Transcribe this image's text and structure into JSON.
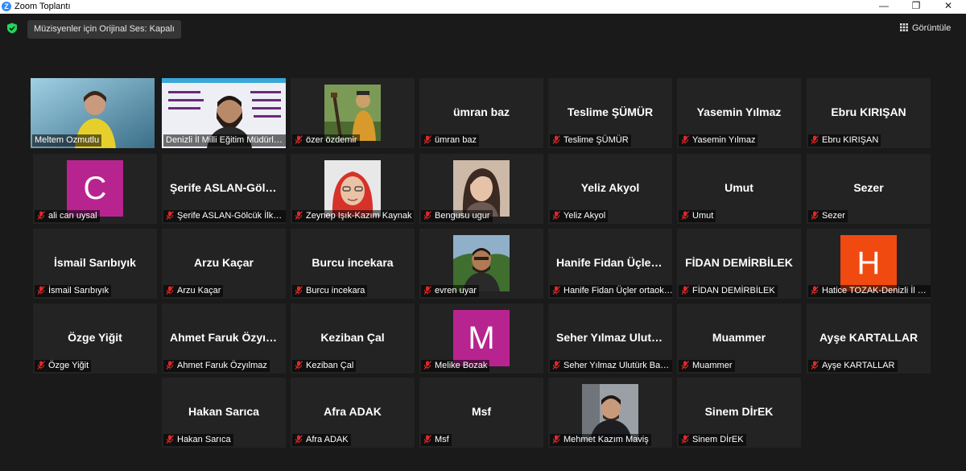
{
  "window": {
    "title": "Zoom Toplantı",
    "logo": "Z"
  },
  "header": {
    "original_sound": "Müzisyenler için Orijinal Ses: Kapalı",
    "view_label": "Görüntüle"
  },
  "colors": {
    "active_speaker": "#b6e35b",
    "muted_mic": "#e02828",
    "tile_bg": "#232323"
  },
  "participants": [
    {
      "label": "Meltem Ozmutlu",
      "muted": false
    },
    {
      "label": "Denizli İl Milli Eğitim Müdürlüğü",
      "muted": false
    },
    {
      "label": "özer özdemir",
      "muted": true
    },
    {
      "name": "ümran baz",
      "label": "ümran baz",
      "muted": true
    },
    {
      "name": "Teslime ŞÜMÜR",
      "label": "Teslime ŞÜMÜR",
      "muted": true
    },
    {
      "name": "Yasemin Yılmaz",
      "label": "Yasemin Yılmaz",
      "muted": true
    },
    {
      "name": "Ebru KIRIŞAN",
      "label": "Ebru KIRIŞAN",
      "muted": true
    },
    {
      "letter": "C",
      "label": "ali can uysal",
      "muted": true
    },
    {
      "name": "Şerife ASLAN-Gölcük İlkokulu",
      "label": "Şerife ASLAN-Gölcük İlkokulu",
      "muted": true
    },
    {
      "label": "Zeynep Işık-Kazım Kaynak",
      "muted": true
    },
    {
      "label": "Bengusu ugur",
      "muted": true
    },
    {
      "name": "Yeliz Akyol",
      "label": "Yeliz Akyol",
      "muted": true
    },
    {
      "name": "Umut",
      "label": "Umut",
      "muted": true
    },
    {
      "name": "Sezer",
      "label": "Sezer",
      "muted": true
    },
    {
      "name": "İsmail Sarıbıyık",
      "label": "İsmail Sarıbıyık",
      "muted": true
    },
    {
      "name": "Arzu Kaçar",
      "label": "Arzu Kaçar",
      "muted": true
    },
    {
      "name": "Burcu incekara",
      "label": "Burcu incekara",
      "muted": true
    },
    {
      "label": "evren uyar",
      "muted": true
    },
    {
      "name": "Hanife Fidan Üçler ortaokulu",
      "label": "Hanife Fidan Üçler ortaokulu",
      "muted": true
    },
    {
      "name": "FİDAN DEMİRBİLEK",
      "label": "FİDAN DEMİRBİLEK",
      "muted": true
    },
    {
      "letter": "H",
      "label": "Hatice TOZAK-Denizli İl Milli",
      "muted": true
    },
    {
      "name": "Özge Yiğit",
      "label": "Özge Yiğit",
      "muted": true
    },
    {
      "name": "Ahmet Faruk Özyılmaz",
      "label": "Ahmet Faruk Özyılmaz",
      "muted": true
    },
    {
      "name": "Keziban Çal",
      "label": "Keziban Çal",
      "muted": true
    },
    {
      "letter": "M",
      "label": "Melike Bozak",
      "muted": true
    },
    {
      "name": "Seher Yılmaz  Ulutürk Başkent",
      "label": "Seher Yılmaz  Ulutürk Başkent",
      "muted": true
    },
    {
      "name": "Muammer",
      "label": "Muammer",
      "muted": true
    },
    {
      "name": "Ayşe KARTALLAR",
      "label": "Ayşe KARTALLAR",
      "muted": true
    },
    {
      "name": "Hakan Sarıca",
      "label": "Hakan Sarıca",
      "muted": true
    },
    {
      "name": "Afra ADAK",
      "label": "Afra ADAK",
      "muted": true
    },
    {
      "name": "Msf",
      "label": "Msf",
      "muted": true
    },
    {
      "label": "Mehmet Kazım Maviş",
      "muted": true
    },
    {
      "name": "Sinem DİrEK",
      "label": "Sinem DİrEK",
      "muted": true
    }
  ]
}
